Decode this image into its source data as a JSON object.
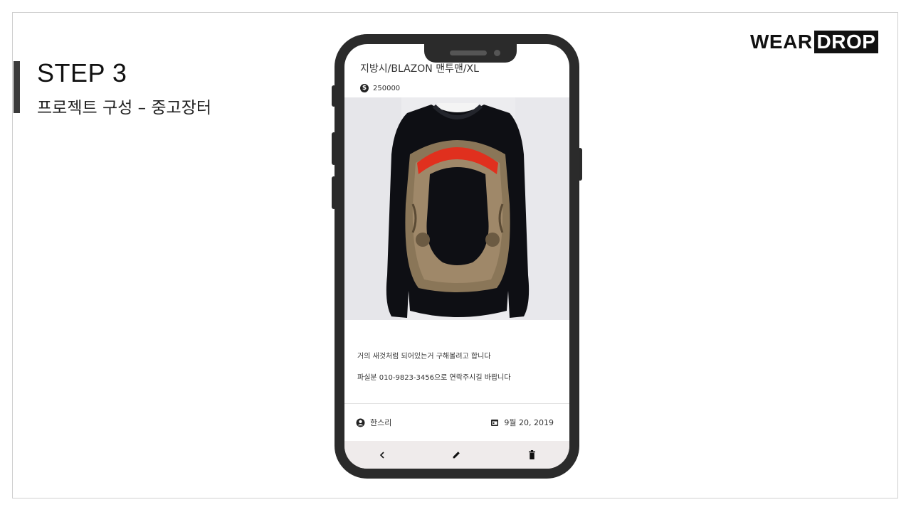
{
  "slide": {
    "step_title": "STEP 3",
    "step_subtitle": "프로젝트 구성 –  중고장터",
    "brand_part1": "WEAR",
    "brand_part2": "DROP"
  },
  "app": {
    "product_title": "지방시/BLAZON 맨투맨/XL",
    "price": "250000",
    "description_line1": "거의 새것처럼 되어있는거 구해볼려고 합니다",
    "description_line2": "파실분 010-9823-3456으로 연락주시길 바랍니다",
    "seller": "한스리",
    "date": "9월 20, 2019",
    "icons": {
      "price": "dollar-coin-icon",
      "seller": "account-circle-icon",
      "date": "calendar-icon",
      "back": "chevron-left-icon",
      "edit": "pencil-icon",
      "delete": "trash-icon"
    },
    "colors": {
      "phone_body": "#2b2b2b",
      "bottom_nav": "#efebeb",
      "sweater": "#0e0f14",
      "banner": "#e0301e"
    }
  }
}
